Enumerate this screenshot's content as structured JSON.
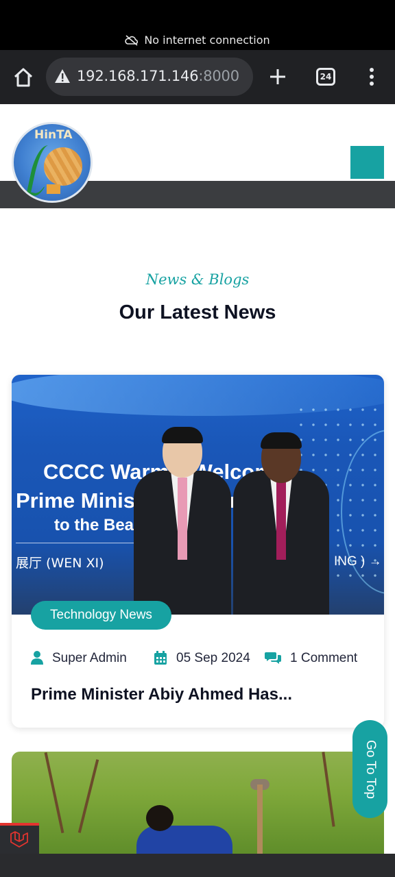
{
  "status": {
    "offline_text": "No internet connection"
  },
  "browser": {
    "url_host": "192.168.171.146",
    "url_port": ":8000",
    "tab_count": "24"
  },
  "site": {
    "logo_text": "HinTA"
  },
  "section": {
    "tag": "News & Blogs",
    "title": "Our Latest News"
  },
  "card": {
    "image_text": {
      "line1": "CCCC Warmly Welcome",
      "line2": "Prime Minister ... ation",
      "line3": "to the Bea...",
      "line4": "展厅 (WEN XI)",
      "line5": "ING ) →"
    },
    "category": "Technology News",
    "author": "Super Admin",
    "date": "05 Sep 2024",
    "comments": "1 Comment",
    "title": "Prime Minister Abiy Ahmed Has..."
  },
  "go_top_label": "Go To Top",
  "colors": {
    "accent": "#17a2a2",
    "dark": "#0e1222"
  }
}
